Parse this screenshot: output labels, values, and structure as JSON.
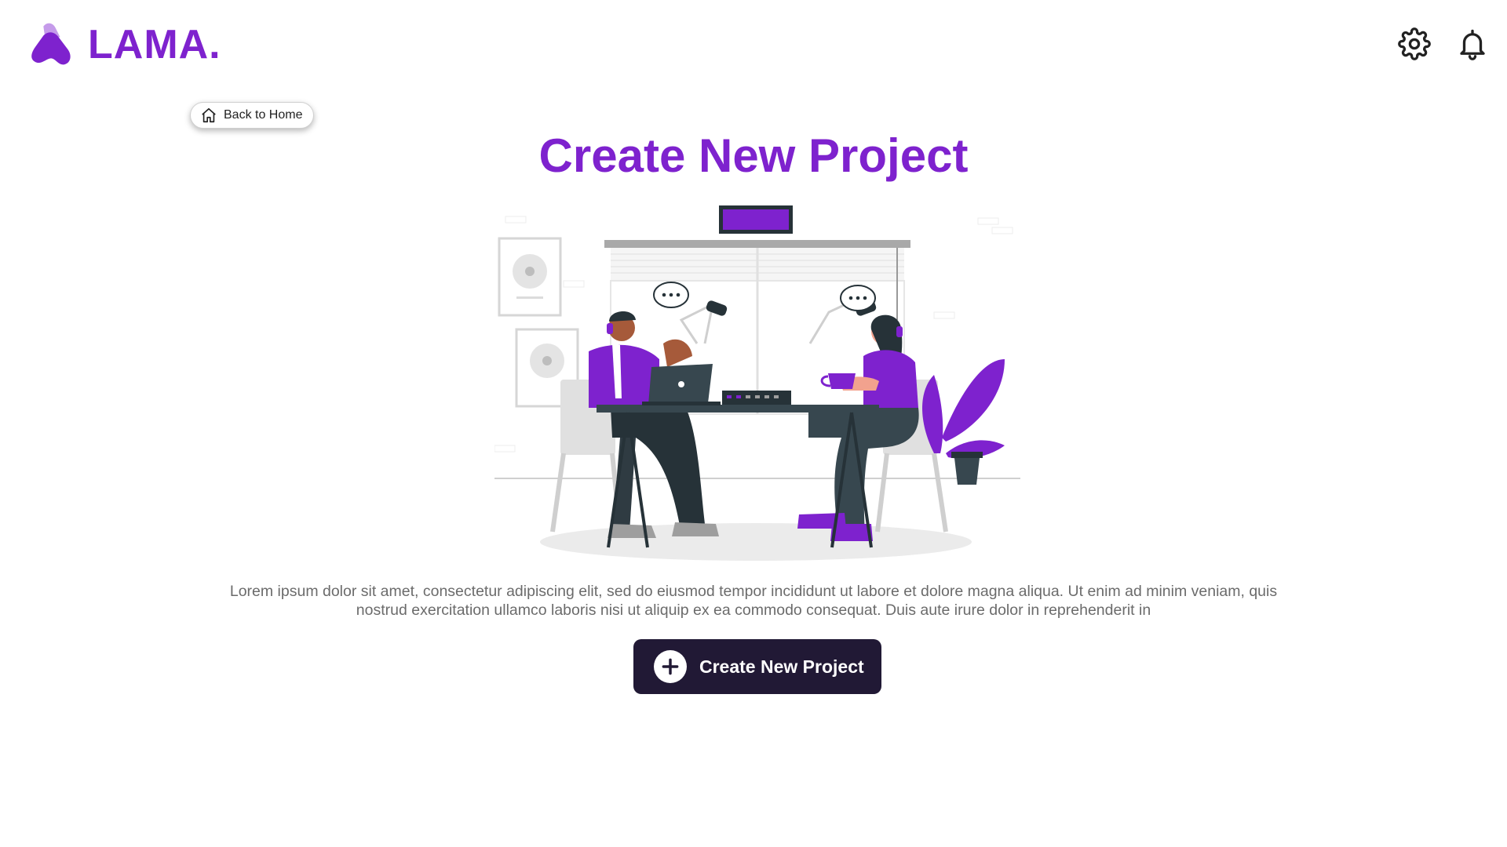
{
  "brand": {
    "name": "LAMA.",
    "color": "#7E22CE",
    "logo_icon": "lama-logo-icon"
  },
  "header": {
    "settings_icon": "gear-icon",
    "notifications_icon": "bell-icon"
  },
  "nav": {
    "back_label": "Back to Home",
    "back_icon": "home-icon"
  },
  "main": {
    "title": "Create New Project",
    "description": "Lorem ipsum dolor sit amet, consectetur adipiscing elit, sed do eiusmod tempor incididunt ut labore et dolore magna aliqua. Ut enim ad minim veniam, quis nostrud exercitation ullamco laboris nisi ut aliquip ex ea commodo consequat. Duis aute irure dolor in reprehenderit in",
    "illustration": "podcast-recording-illustration"
  },
  "actions": {
    "create_label": "Create New Project",
    "create_icon": "plus-circle-icon",
    "button_color": "#211935"
  },
  "colors": {
    "accent": "#7E22CE",
    "text_muted": "#6b6b6b",
    "dark": "#263238"
  }
}
